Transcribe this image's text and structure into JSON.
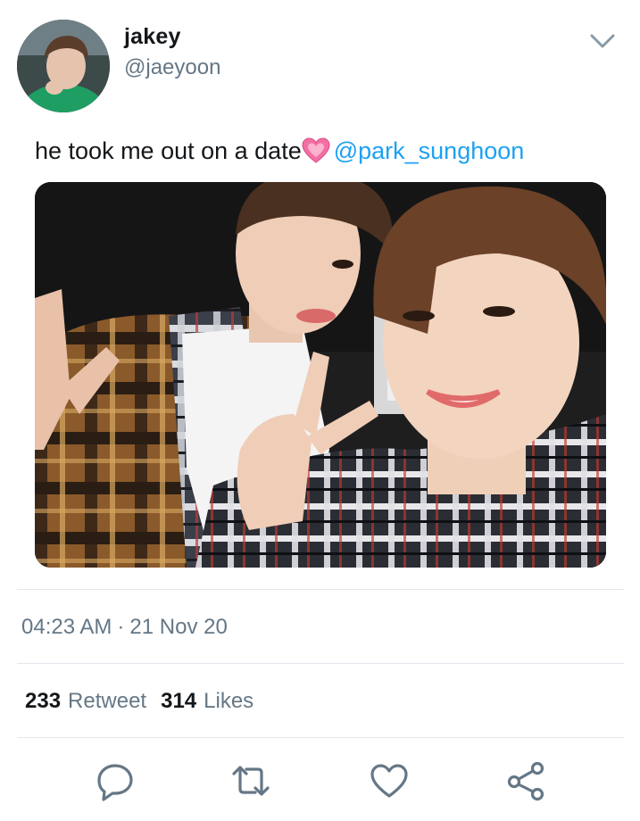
{
  "user": {
    "display_name": "jakey",
    "handle": "@jaeyoon"
  },
  "tweet": {
    "text": "he took me out on a date",
    "emoji": "pink-heart-emoji",
    "mention": "@park_sunghoon",
    "image": "selfie-photo"
  },
  "meta": {
    "time": "04:23 AM",
    "separator": "·",
    "date": "21 Nov 20"
  },
  "stats": {
    "retweets_count": "233",
    "retweets_label": "Retweet",
    "likes_count": "314",
    "likes_label": "Likes"
  },
  "icons": {
    "menu": "chevron-down-icon",
    "reply": "reply-icon",
    "retweet": "retweet-icon",
    "like": "like-icon",
    "share": "share-icon"
  },
  "colors": {
    "link": "#1da1f2",
    "text": "#14171a",
    "secondary": "#657786",
    "divider": "#e1e8ed",
    "icon": "#657786"
  }
}
